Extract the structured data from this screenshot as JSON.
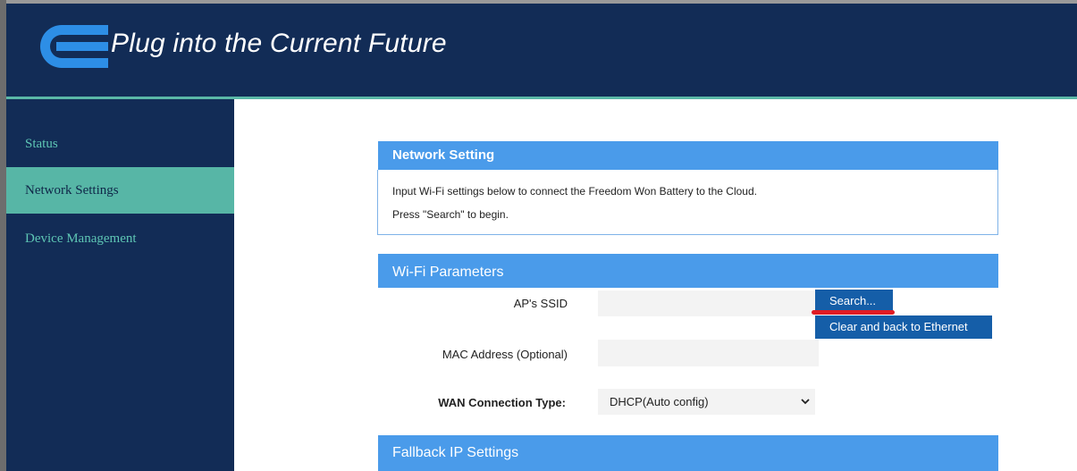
{
  "header": {
    "tagline": "Plug into the Current Future",
    "logo_icon": "freedom-won-e-logo-icon"
  },
  "colors": {
    "header_bg": "#122c56",
    "accent_teal": "#5ab8a7",
    "panel_blue": "#4a9bea",
    "button_blue": "#155ea8",
    "annotation_red": "#e01c24"
  },
  "sidebar": {
    "items": [
      {
        "label": "Status",
        "active": false
      },
      {
        "label": "Network Settings",
        "active": true
      },
      {
        "label": "Device Management",
        "active": false
      }
    ]
  },
  "network_setting": {
    "title": "Network Setting",
    "line1": "Input Wi-Fi settings below to connect the Freedom Won Battery to the Cloud.",
    "line2": "Press \"Search\" to begin."
  },
  "wifi": {
    "title": "Wi-Fi Parameters",
    "ssid_label": "AP's SSID",
    "ssid_value": "",
    "search_button": "Search...",
    "clear_button": "Clear and back to Ethernet",
    "mac_label": "MAC Address (Optional)",
    "mac_value": "",
    "wan_label": "WAN Connection Type:",
    "wan_value": "DHCP(Auto config)"
  },
  "fallback": {
    "title": "Fallback IP Settings"
  }
}
